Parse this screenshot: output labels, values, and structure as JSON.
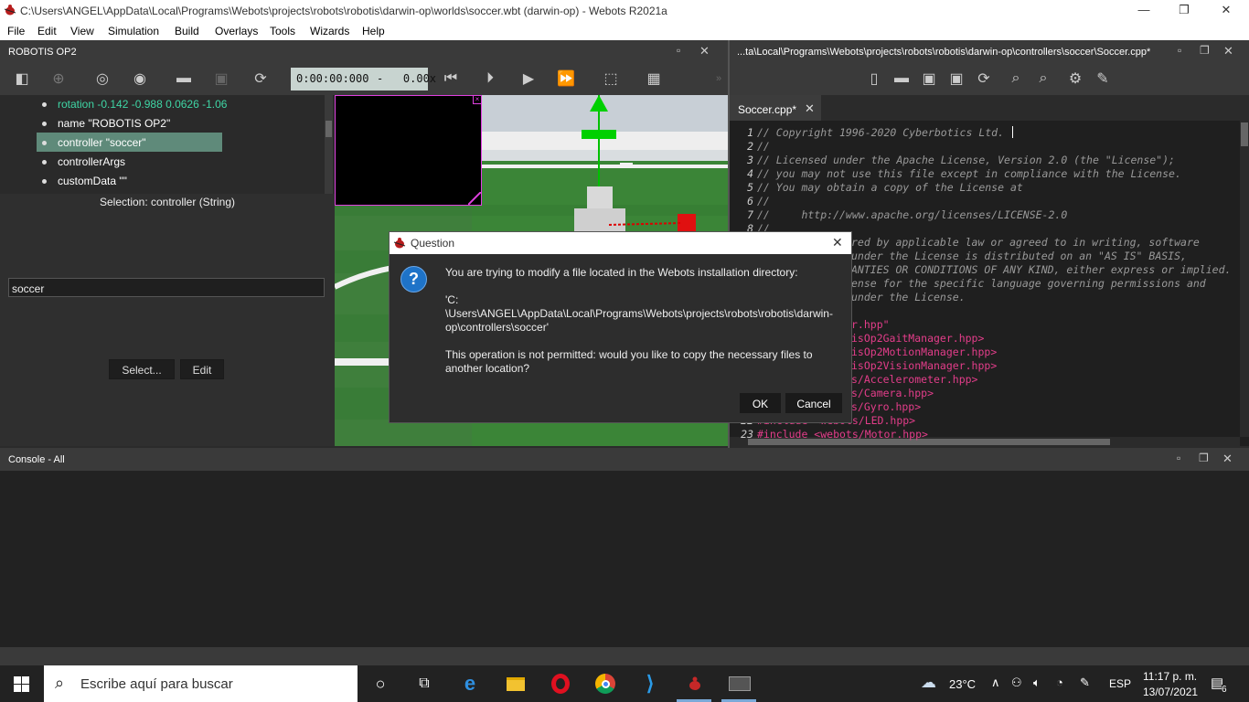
{
  "window": {
    "title": "C:\\Users\\ANGEL\\AppData\\Local\\Programs\\Webots\\projects\\robots\\robotis\\darwin-op\\worlds\\soccer.wbt (darwin-op) - Webots R2021a",
    "minimize": "—",
    "restore": "❐",
    "close": "✕"
  },
  "menu": [
    "File",
    "Edit",
    "View",
    "Simulation",
    "Build",
    "Overlays",
    "Tools",
    "Wizards",
    "Help"
  ],
  "scene_panel": {
    "title": "ROBOTIS OP2",
    "time": "0:00:00:000",
    "speed": "-   0.00x",
    "tree": [
      {
        "label": "rotation -0.142 -0.988 0.0626 -1.06",
        "color": "#3fd6a5"
      },
      {
        "label": "name \"ROBOTIS OP2\"",
        "color": "#ffffff"
      },
      {
        "label": "controller \"soccer\"",
        "color": "#ffffff"
      },
      {
        "label": "controllerArgs",
        "color": "#ffffff"
      },
      {
        "label": "customData \"\"",
        "color": "#ffffff"
      }
    ],
    "selection": "Selection: controller (String)",
    "field_value": "soccer",
    "select_button": "Select...",
    "edit_button": "Edit"
  },
  "editor": {
    "path": "...ta\\Local\\Programs\\Webots\\projects\\robots\\robotis\\darwin-op\\controllers\\soccer\\Soccer.cpp*",
    "tab": "Soccer.cpp*",
    "lines": [
      {
        "n": "1",
        "text": "// Copyright 1996-2020 Cyberbotics Ltd."
      },
      {
        "n": "2",
        "text": "//"
      },
      {
        "n": "3",
        "text": "// Licensed under the Apache License, Version 2.0 (the \"License\");"
      },
      {
        "n": "4",
        "text": "// you may not use this file except in compliance with the License."
      },
      {
        "n": "5",
        "text": "// You may obtain a copy of the License at"
      },
      {
        "n": "6",
        "text": "//"
      },
      {
        "n": "7",
        "text": "//     http://www.apache.org/licenses/LICENSE-2.0"
      },
      {
        "n": "8",
        "text": "//"
      }
    ],
    "right_lines": [
      "red by applicable law or agreed to in writing, software",
      "under the License is distributed on an \"AS IS\" BASIS,",
      "ANTIES OR CONDITIONS OF ANY KIND, either express or implied.",
      "ense for the specific language governing permissions and",
      "under the License."
    ],
    "includes": [
      "r.hpp\"",
      "isOp2GaitManager.hpp>",
      "isOp2MotionManager.hpp>",
      "isOp2VisionManager.hpp>",
      "s/Accelerometer.hpp>",
      "s/Camera.hpp>",
      "s/Gyro.hpp>",
      "#include <webots/LED.hpp>",
      "#include <webots/Motor.hpp>"
    ],
    "last_numbers": [
      "22",
      "23"
    ]
  },
  "console": {
    "title": "Console - All"
  },
  "dialog": {
    "title": "Question",
    "line1": "You are trying to modify a file located in the Webots installation directory:",
    "path1": "'C:",
    "path2": "\\Users\\ANGEL\\AppData\\Local\\Programs\\Webots\\projects\\robots\\robotis\\darwin-",
    "path3": "op\\controllers\\soccer'",
    "question1": "This operation is not permitted: would you like to copy the necessary files to",
    "question2": "another location?",
    "ok": "OK",
    "cancel": "Cancel",
    "close": "✕"
  },
  "taskbar": {
    "search_placeholder": "Escribe aquí para buscar",
    "weather": "23°C",
    "language": "ESP",
    "time": "11:17 p. m.",
    "date": "13/07/2021",
    "notifications": "6"
  }
}
